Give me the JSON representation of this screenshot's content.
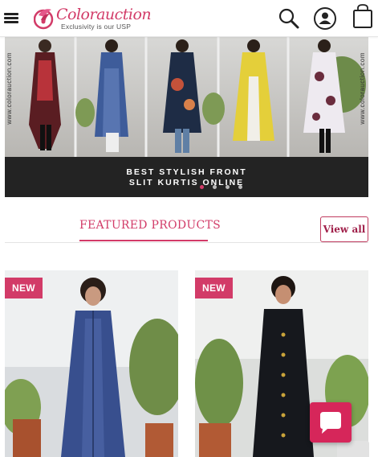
{
  "header": {
    "brand_name": "Colorauction",
    "brand_tagline": "Exclusivity is our USP",
    "icons": [
      "menu-icon",
      "search-icon",
      "account-icon",
      "shopping-bag-icon"
    ]
  },
  "banner": {
    "side_text_left": "www.colorauction.com",
    "side_text_right": "www.colorauction.com",
    "caption_line1": "BEST STYLISH FRONT",
    "caption_line2": "SLIT KURTIS ONLINE",
    "slide_count": 4,
    "active_slide": 1
  },
  "featured": {
    "title": "FEATURED PRODUCTS",
    "view_all_label": "View all"
  },
  "products": [
    {
      "badge": "NEW"
    },
    {
      "badge": "NEW"
    }
  ],
  "colors": {
    "brand": "#d23b68",
    "badge": "#d23b68",
    "chat": "#d6265a"
  }
}
